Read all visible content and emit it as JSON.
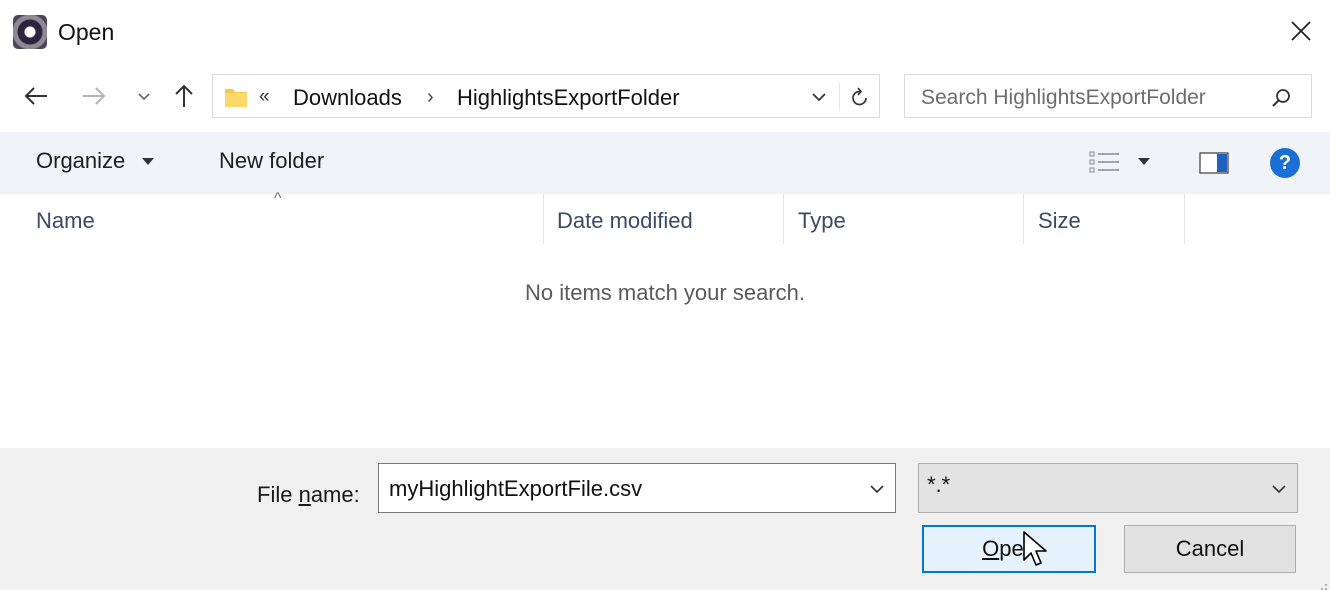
{
  "window": {
    "title": "Open",
    "app_icon": "app-logo-icon",
    "close_icon": "close-icon"
  },
  "navigation": {
    "back_icon": "arrow-left-icon",
    "forward_icon": "arrow-right-icon",
    "recent_icon": "chevron-down-icon",
    "up_icon": "arrow-up-icon"
  },
  "address": {
    "overflow": "«",
    "crumbs": [
      "Downloads",
      "HighlightsExportFolder"
    ],
    "separator": "›",
    "folder_icon": "folder-icon",
    "dropdown_icon": "chevron-down-icon",
    "refresh_icon": "refresh-icon"
  },
  "search": {
    "placeholder": "Search HighlightsExportFolder",
    "icon": "search-icon"
  },
  "toolbar": {
    "organize_label": "Organize",
    "new_folder_label": "New folder",
    "view_icon": "view-details-icon",
    "preview_pane_icon": "preview-pane-icon",
    "help_label": "?"
  },
  "columns": [
    "Name",
    "Date modified",
    "Type",
    "Size"
  ],
  "file_list": {
    "empty_message": "No items match your search."
  },
  "file_name": {
    "label_prefix": "File ",
    "label_underlined": "n",
    "label_suffix": "ame:",
    "value": "myHighlightExportFile.csv"
  },
  "file_type": {
    "selected": "*.*"
  },
  "buttons": {
    "open_underlined": "O",
    "open_rest": "pen",
    "cancel": "Cancel"
  },
  "colors": {
    "accent": "#0078d7",
    "toolbar_bg": "#f0f4f9",
    "footer_bg": "#f0f0f0",
    "help_blue": "#1a6fd6",
    "folder_yellow": "#f6c94a"
  }
}
